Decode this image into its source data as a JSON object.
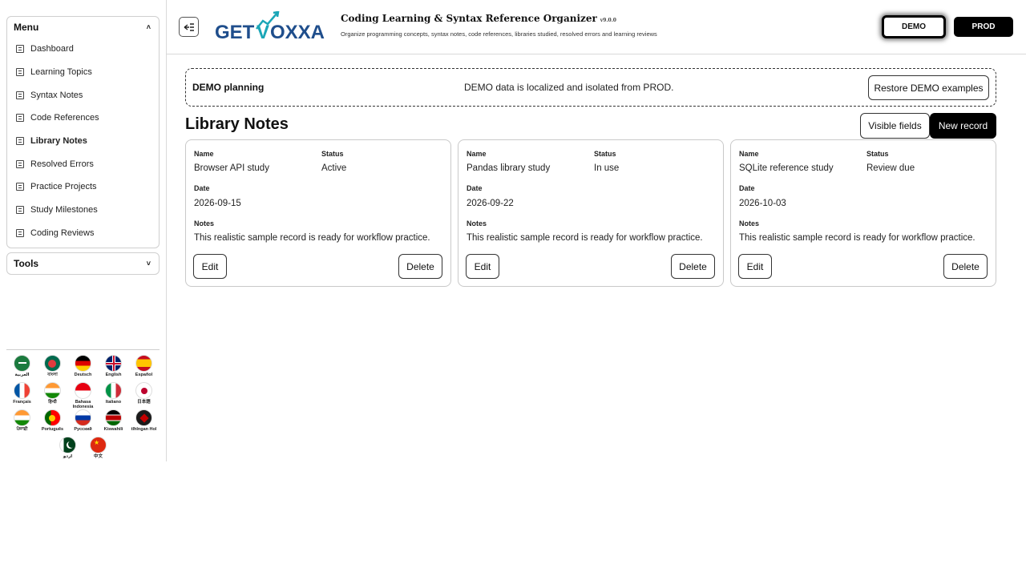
{
  "sidebar": {
    "menu_title": "Menu",
    "menu_caret": "˄",
    "items": [
      {
        "label": "Dashboard"
      },
      {
        "label": "Learning Topics"
      },
      {
        "label": "Syntax Notes"
      },
      {
        "label": "Code References"
      },
      {
        "label": "Library Notes"
      },
      {
        "label": "Resolved Errors"
      },
      {
        "label": "Practice Projects"
      },
      {
        "label": "Study Milestones"
      },
      {
        "label": "Coding Reviews"
      }
    ],
    "active_item": "Library Notes",
    "tools_title": "Tools",
    "tools_caret": "˅"
  },
  "languages": [
    {
      "label": "العربية",
      "icon": "saudi-flag-icon"
    },
    {
      "label": "বাংলা",
      "icon": "bangladesh-flag-icon"
    },
    {
      "label": "Deutsch",
      "icon": "germany-flag-icon"
    },
    {
      "label": "English",
      "icon": "uk-flag-icon"
    },
    {
      "label": "Español",
      "icon": "spain-flag-icon"
    },
    {
      "label": "Français",
      "icon": "france-flag-icon"
    },
    {
      "label": "हिन्दी",
      "icon": "india-flag-icon"
    },
    {
      "label": "Bahasa Indonesia",
      "icon": "indonesia-flag-icon"
    },
    {
      "label": "Italiano",
      "icon": "italy-flag-icon"
    },
    {
      "label": "日本語",
      "icon": "japan-flag-icon"
    },
    {
      "label": "ਪੰਜਾਬੀ",
      "icon": "india-flag-icon"
    },
    {
      "label": "Português",
      "icon": "portugal-flag-icon"
    },
    {
      "label": "Русский",
      "icon": "russia-flag-icon"
    },
    {
      "label": "Kiswahili",
      "icon": "kenya-flag-icon"
    },
    {
      "label": "tlhIngan Hol",
      "icon": "klingon-flag-icon"
    },
    {
      "label": "اردو",
      "icon": "pakistan-flag-icon"
    },
    {
      "label": "中文",
      "icon": "china-flag-icon"
    }
  ],
  "header": {
    "collapse_icon": "collapse-sidebar-icon",
    "logo_text": "GETVOXXA",
    "title": "Coding Learning & Syntax Reference Organizer",
    "version": "v9.0.0",
    "subtitle": "Organize programming concepts, syntax notes, code references, libraries studied, resolved errors and learning reviews",
    "env_demo": "DEMO",
    "env_prod": "PROD"
  },
  "banner": {
    "title": "DEMO planning",
    "message": "DEMO data is localized and isolated from PROD.",
    "restore_label": "Restore DEMO examples"
  },
  "main": {
    "page_title": "Library Notes",
    "visible_fields_label": "Visible fields",
    "new_record_label": "New record",
    "field_labels": {
      "name": "Name",
      "status": "Status",
      "date": "Date",
      "notes": "Notes"
    },
    "edit_label": "Edit",
    "delete_label": "Delete",
    "records": [
      {
        "name": "Browser API study",
        "status": "Active",
        "date": "2026-09-15",
        "notes": "This realistic sample record is ready for workflow practice."
      },
      {
        "name": "Pandas library study",
        "status": "In use",
        "date": "2026-09-22",
        "notes": "This realistic sample record is ready for workflow practice."
      },
      {
        "name": "SQLite reference study",
        "status": "Review due",
        "date": "2026-10-03",
        "notes": "This realistic sample record is ready for workflow practice."
      }
    ]
  },
  "colors": {
    "primary": "#000000",
    "logo_blue": "#1f4e8c",
    "logo_teal": "#1aa6b7"
  }
}
